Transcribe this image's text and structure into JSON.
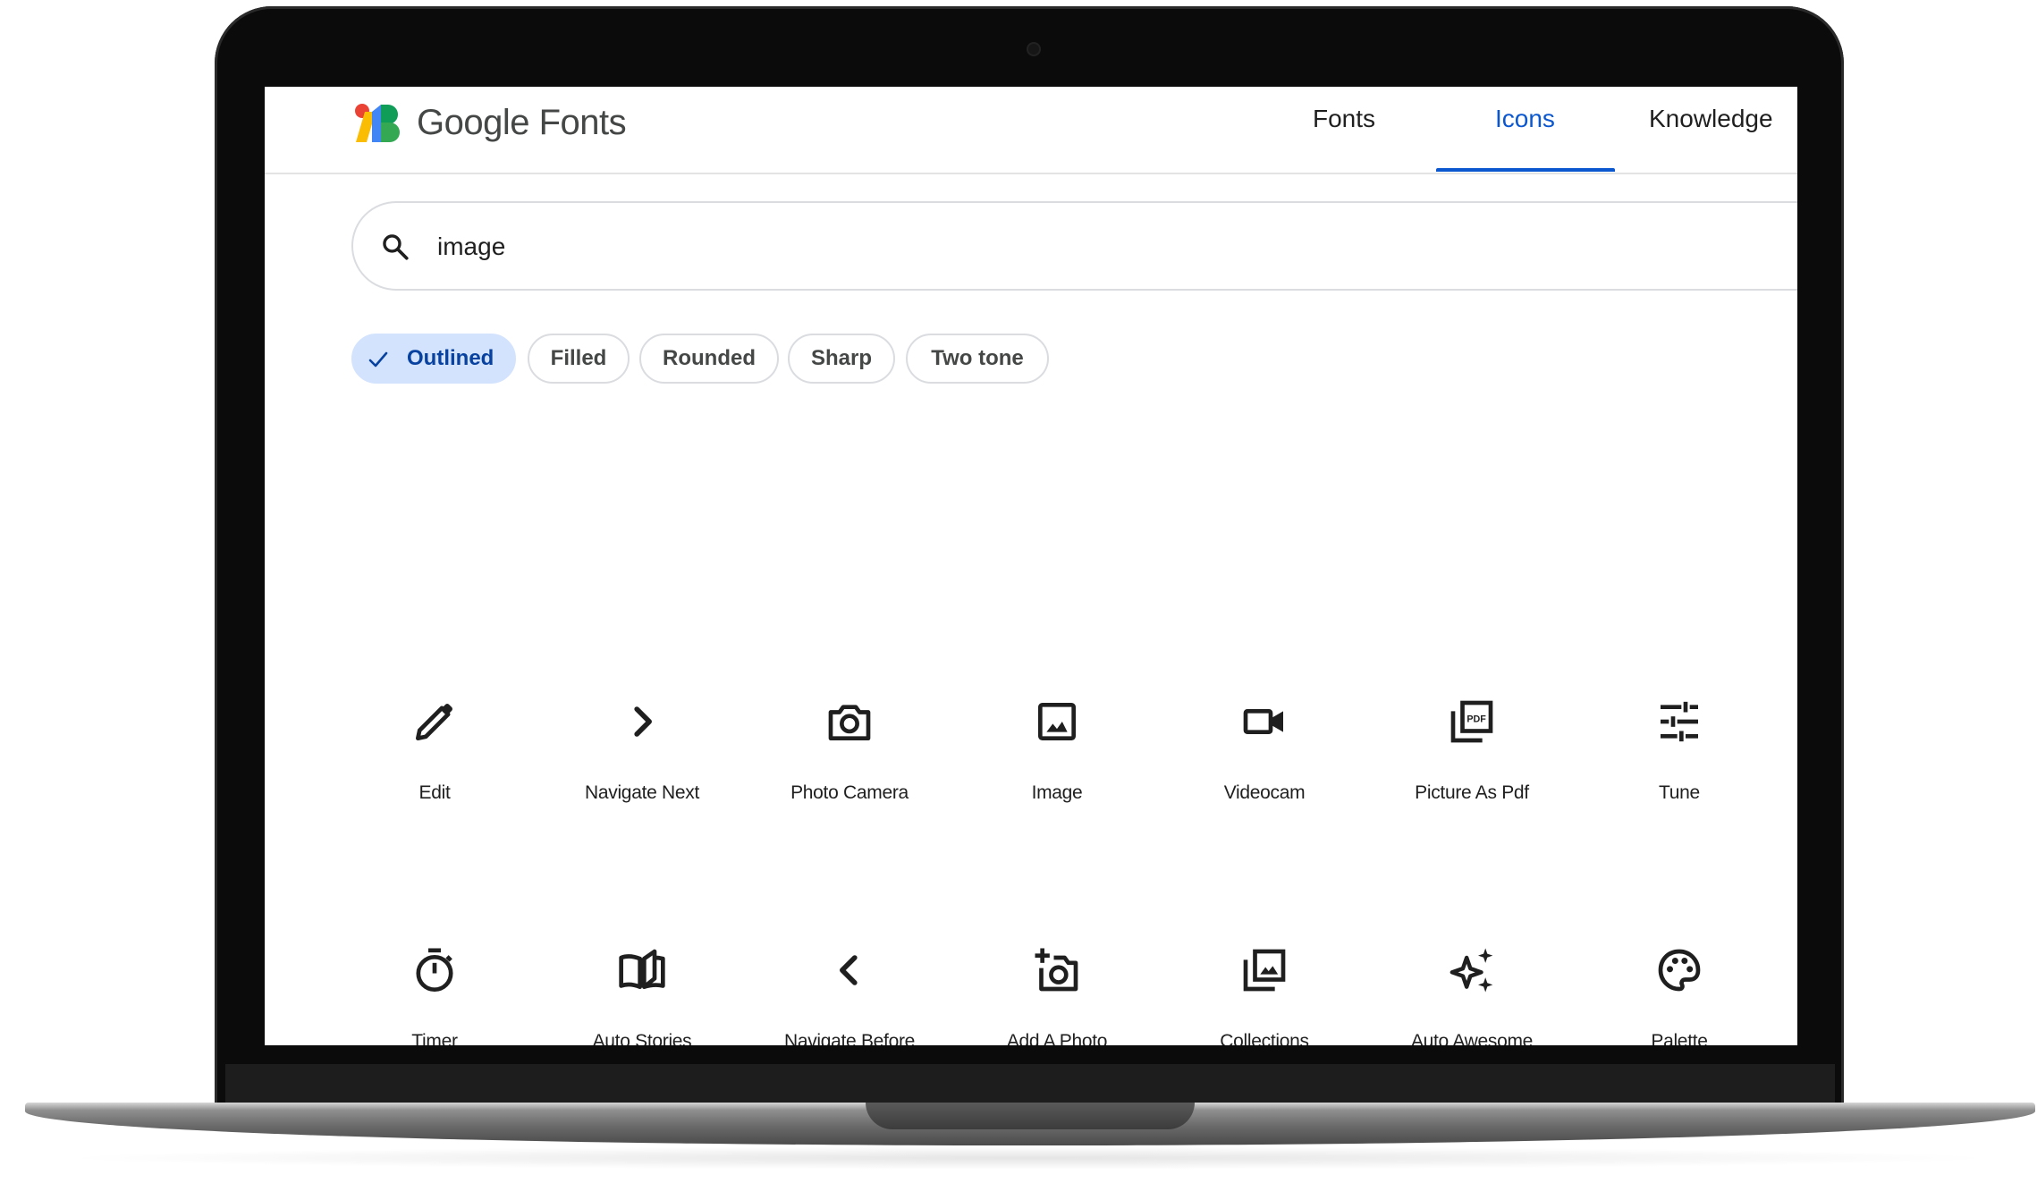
{
  "header": {
    "brand": "Google Fonts",
    "nav": [
      {
        "label": "Fonts",
        "active": false
      },
      {
        "label": "Icons",
        "active": true
      },
      {
        "label": "Knowledge",
        "active": false
      }
    ]
  },
  "search": {
    "value": "image",
    "icon": "search-icon"
  },
  "filters": {
    "chips": [
      {
        "label": "Outlined",
        "selected": true
      },
      {
        "label": "Filled",
        "selected": false
      },
      {
        "label": "Rounded",
        "selected": false
      },
      {
        "label": "Sharp",
        "selected": false
      },
      {
        "label": "Two tone",
        "selected": false
      }
    ]
  },
  "icons": [
    {
      "label": "Edit",
      "icon": "edit-icon"
    },
    {
      "label": "Navigate Next",
      "icon": "navigate-next-icon"
    },
    {
      "label": "Photo Camera",
      "icon": "photo-camera-icon"
    },
    {
      "label": "Image",
      "icon": "image-icon"
    },
    {
      "label": "Videocam",
      "icon": "videocam-icon"
    },
    {
      "label": "Picture As Pdf",
      "icon": "picture-as-pdf-icon"
    },
    {
      "label": "Tune",
      "icon": "tune-icon"
    },
    {
      "label": "Timer",
      "icon": "timer-icon"
    },
    {
      "label": "Auto Stories",
      "icon": "auto-stories-icon"
    },
    {
      "label": "Navigate Before",
      "icon": "navigate-before-icon"
    },
    {
      "label": "Add A Photo",
      "icon": "add-a-photo-icon"
    },
    {
      "label": "Collections",
      "icon": "collections-icon"
    },
    {
      "label": "Auto Awesome",
      "icon": "auto-awesome-icon"
    },
    {
      "label": "Palette",
      "icon": "palette-icon"
    }
  ],
  "colors": {
    "accent": "#0b57d0",
    "chip_selected_bg": "#d3e3fd",
    "chip_selected_text": "#0842a0",
    "text": "#1f1f1f"
  }
}
